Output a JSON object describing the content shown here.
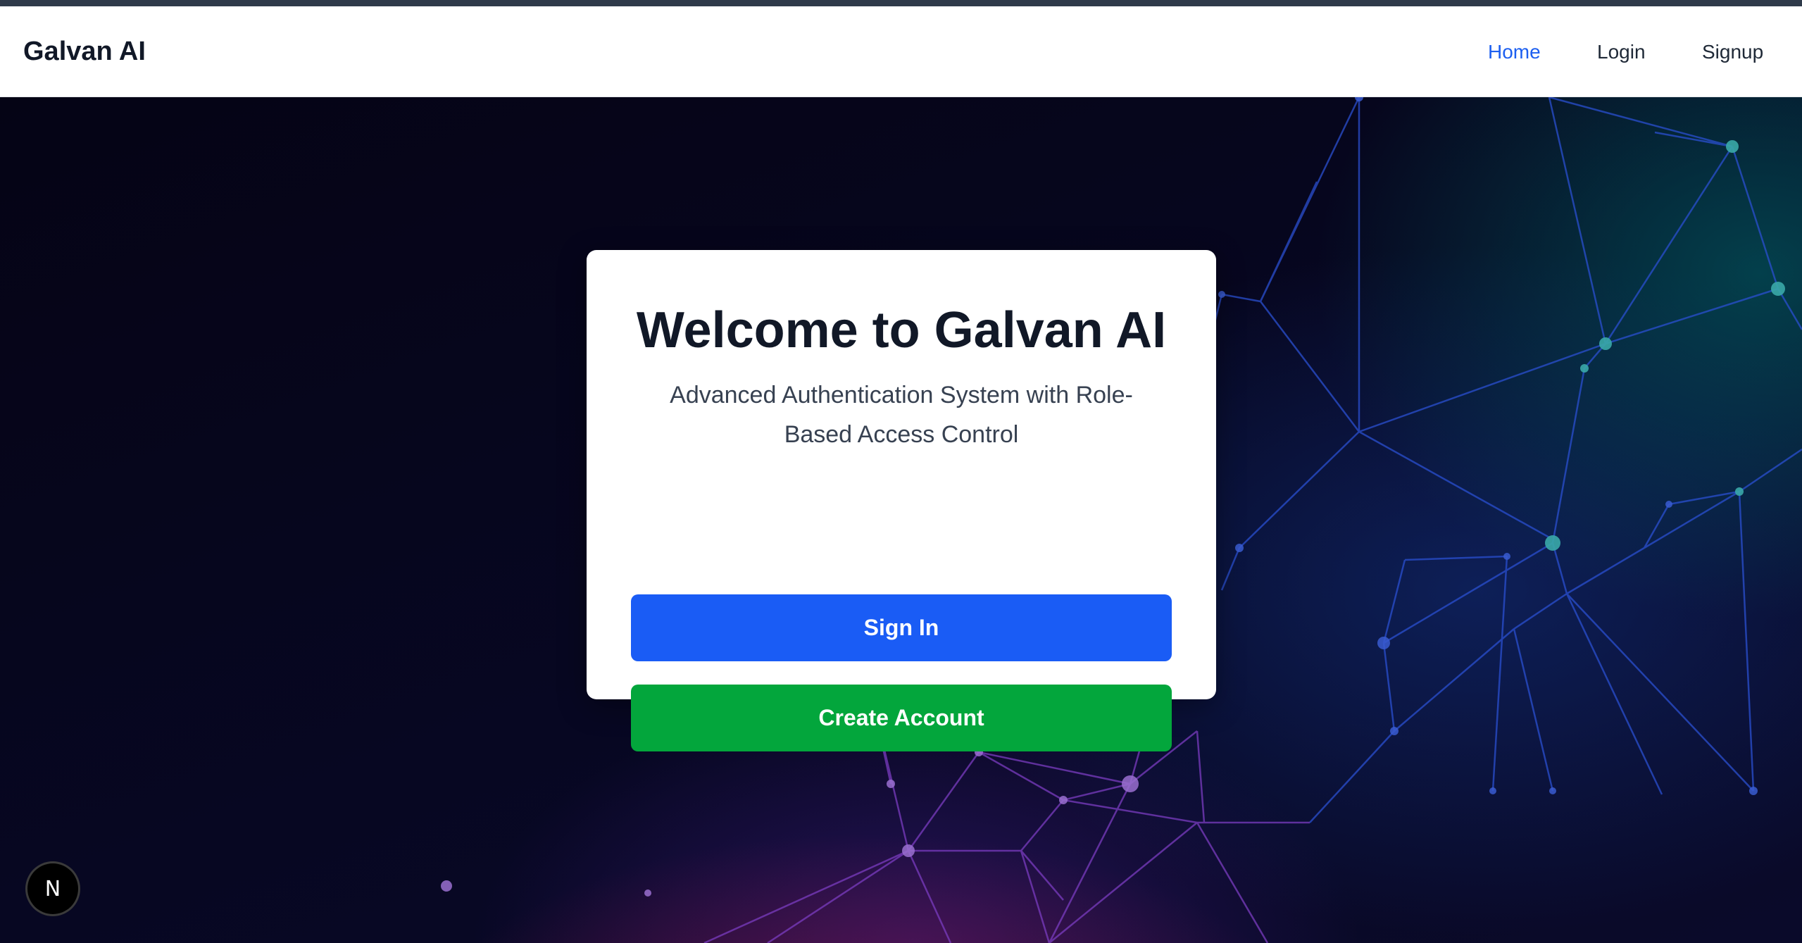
{
  "brand": {
    "name": "Galvan AI"
  },
  "nav": {
    "links": [
      {
        "label": "Home",
        "active": true
      },
      {
        "label": "Login",
        "active": false
      },
      {
        "label": "Signup",
        "active": false
      }
    ]
  },
  "hero": {
    "title": "Welcome to Galvan AI",
    "subtitle": "Advanced Authentication System with Role-Based Access Control",
    "sign_in_label": "Sign In",
    "create_account_label": "Create Account"
  },
  "dev_indicator": {
    "glyph": "N",
    "icon": "nextjs-icon"
  },
  "colors": {
    "accent": "#1d5ff0",
    "sign_in_button": "#1a5cf5",
    "create_account_button": "#03a63c",
    "hero_background": "#070722"
  }
}
